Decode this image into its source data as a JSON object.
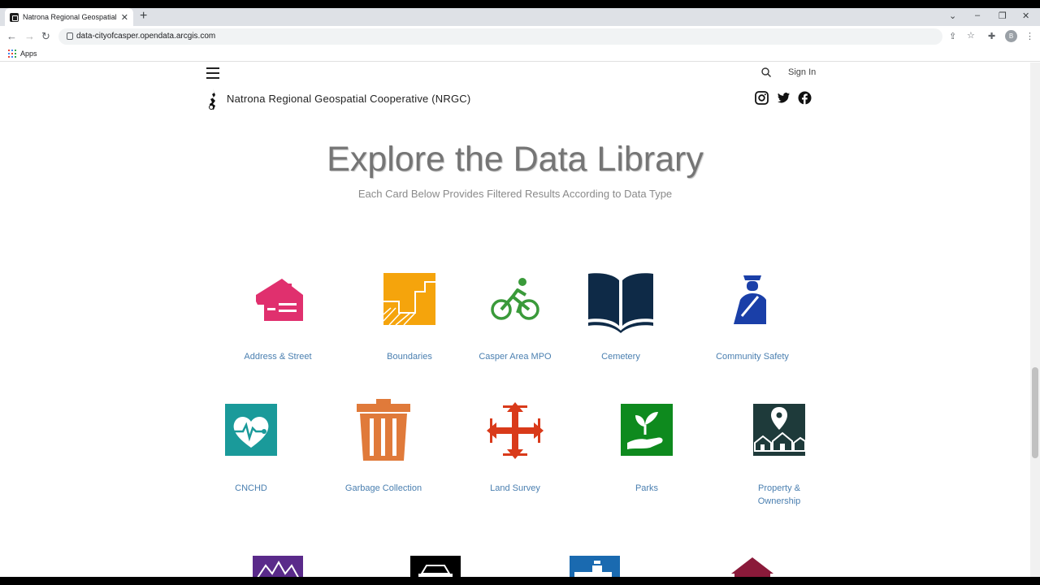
{
  "browser": {
    "tab_title": "Natrona Regional Geospatial Co",
    "url": "data-cityofcasper.opendata.arcgis.com",
    "bookmarks_apps_label": "Apps",
    "profile_initial": "B"
  },
  "site": {
    "title": "Natrona Regional Geospatial Cooperative (NRGC)",
    "sign_in_label": "Sign In"
  },
  "hero": {
    "title": "Explore the Data Library",
    "subtitle": "Each Card Below Provides Filtered Results According to Data Type"
  },
  "cards_row1": [
    {
      "label": "Address & Street",
      "icon": "house-icon",
      "color": "#e0306e"
    },
    {
      "label": "Boundaries",
      "icon": "boundaries-icon",
      "color": "#f5a40c"
    },
    {
      "label": "Casper Area MPO",
      "icon": "bicycle-icon",
      "color": "#3a9a3a"
    },
    {
      "label": "Cemetery",
      "icon": "book-icon",
      "color": "#0e2a47"
    },
    {
      "label": "Community Safety",
      "icon": "officer-icon",
      "color": "#1a3fa8"
    }
  ],
  "cards_row2": [
    {
      "label": "CNCHD",
      "icon": "heart-health-icon",
      "color": "#1a9a9a"
    },
    {
      "label": "Garbage Collection",
      "icon": "trash-can-icon",
      "color": "#e07a3a"
    },
    {
      "label": "Land Survey",
      "icon": "survey-arrows-icon",
      "color": "#d93a1a"
    },
    {
      "label": "Parks",
      "icon": "plant-hand-icon",
      "color": "#0e8a1e"
    },
    {
      "label_line1": "Property &",
      "label_line2": "Ownership",
      "icon": "property-pin-icon",
      "color": "#1e3a3a"
    }
  ],
  "cards_row3": [
    {
      "icon": "mountain-icon",
      "color": "#5a2a8a"
    },
    {
      "icon": "car-icon",
      "color": "#000000"
    },
    {
      "icon": "water-faucet-icon",
      "color": "#1a6ab0"
    },
    {
      "icon": "roof-icon",
      "color": "#8a1a3a"
    }
  ]
}
